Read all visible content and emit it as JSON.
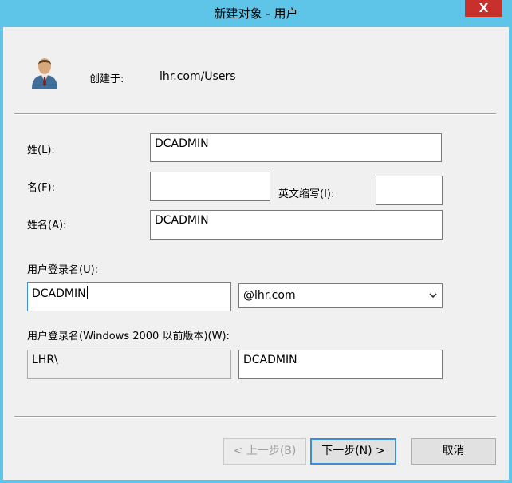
{
  "window": {
    "title": "新建对象 - 用户",
    "close_label": "X"
  },
  "header": {
    "created_in_label": "创建于:",
    "created_in_value": "lhr.com/Users",
    "icon": "user-icon"
  },
  "form": {
    "last_name_label": "姓(L):",
    "last_name_value": "DCADMIN",
    "first_name_label": "名(F):",
    "first_name_value": "",
    "initials_label": "英文缩写(I):",
    "initials_value": "",
    "full_name_label": "姓名(A):",
    "full_name_value": "DCADMIN",
    "logon_name_label": "用户登录名(U):",
    "logon_name_value": "DCADMIN",
    "domain_suffix_value": "@lhr.com",
    "legacy_logon_label": "用户登录名(Windows 2000 以前版本)(W):",
    "legacy_domain_value": "LHR\\",
    "legacy_logon_value": "DCADMIN"
  },
  "buttons": {
    "back_label": "< 上一步(B)",
    "next_label": "下一步(N) >",
    "cancel_label": "取消"
  },
  "colors": {
    "title_bar": "#5ec4e8",
    "close_button": "#c7302b",
    "focus_border": "#3c8fd6"
  }
}
